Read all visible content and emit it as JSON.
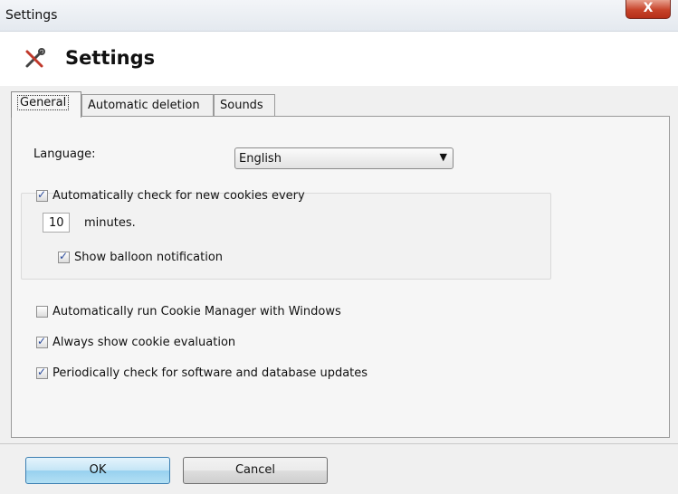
{
  "window": {
    "title": "Settings",
    "close_label": "X"
  },
  "header": {
    "title": "Settings",
    "icon": "tools-icon"
  },
  "tabs": [
    {
      "label": "General",
      "active": true
    },
    {
      "label": "Automatic deletion",
      "active": false
    },
    {
      "label": "Sounds",
      "active": false
    }
  ],
  "general": {
    "language_label": "Language:",
    "language_value": "English",
    "auto_check": {
      "label": "Automatically check for new cookies every",
      "checked": true
    },
    "minutes_value": "10",
    "minutes_label": "minutes.",
    "balloon": {
      "label": "Show balloon notification",
      "checked": true
    },
    "run_with_windows": {
      "label": "Automatically run Cookie Manager with Windows",
      "checked": false
    },
    "show_evaluation": {
      "label": "Always show cookie evaluation",
      "checked": true
    },
    "check_updates": {
      "label": "Periodically check for software and database updates",
      "checked": true
    }
  },
  "buttons": {
    "ok": "OK",
    "cancel": "Cancel"
  },
  "colors": {
    "accent": "#3c7fb1",
    "close": "#c7432a"
  }
}
